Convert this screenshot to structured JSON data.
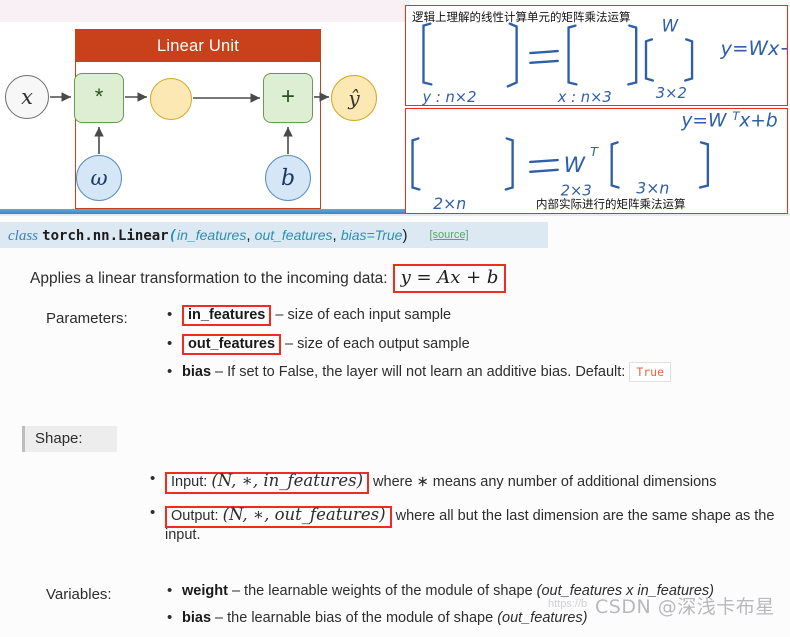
{
  "diagram": {
    "title": "Linear Unit",
    "nodes": {
      "input": "𝑥",
      "multiply": "*",
      "intermediate": "",
      "add": "+",
      "output": "ŷ",
      "weight": "ω",
      "bias": "b"
    }
  },
  "annotations": {
    "top": {
      "caption": "逻辑上理解的线性计算单元的矩阵乘法运算",
      "equation": "y = Wx + b",
      "w_label": "W",
      "lhs_label": "y : n×2",
      "x_label": "x : n×3",
      "w_dim_label": "3×2",
      "equals": "="
    },
    "bottom": {
      "caption": "内部实际进行的矩阵乘法运算",
      "equation": "y = WᵀX + b",
      "lhs_label": "2×n",
      "wt_label": "Wᵀ",
      "wt_dim_label": "2×3",
      "x_dim_label": "3×n",
      "equals": "="
    }
  },
  "doc": {
    "signature": {
      "class_keyword": "class",
      "qualified_name": "torch.nn.Linear",
      "open_paren": "(",
      "params": [
        "in_features",
        "out_features",
        "bias=True"
      ],
      "close_paren": ")",
      "source_link": "[source]"
    },
    "description": {
      "text": "Applies a linear transformation to the incoming data:",
      "formula": "y = Ax + b"
    },
    "parameters_label": "Parameters:",
    "parameters": [
      {
        "name": "in_features",
        "highlighted": true,
        "desc": " – size of each input sample"
      },
      {
        "name": "out_features",
        "highlighted": true,
        "desc": " – size of each output sample"
      },
      {
        "name": "bias",
        "highlighted": false,
        "desc": " – If set to False, the layer will not learn an additive bias. Default: ",
        "badge": "True"
      }
    ],
    "shape_label": "Shape:",
    "shapes": [
      {
        "prefix": "Input: ",
        "formula": "(N, ∗, in_features)",
        "suffix": " where ∗ means any number of additional dimensions"
      },
      {
        "prefix": "Output: ",
        "formula": "(N, ∗, out_features)",
        "suffix": " where all but the last dimension are the same shape as the input."
      }
    ],
    "variables_label": "Variables:",
    "variables": [
      {
        "name": "weight",
        "desc": " – the learnable weights of the module of shape ",
        "shape": "(out_features x in_features)"
      },
      {
        "name": "bias",
        "desc": " – the learnable bias of the module of shape ",
        "shape": "(out_features)"
      }
    ]
  },
  "watermark": {
    "text": "CSDN @深浅卡布星",
    "url": "https://b"
  },
  "colors": {
    "header_red": "#c9411a",
    "highlight_red": "#f02b20",
    "green_box": "#ddeed3",
    "blue_node": "#d5e6f7",
    "yellow_node": "#fce8b2",
    "sig_bar": "#dce9f3",
    "ink_blue": "#2f5fa8"
  }
}
